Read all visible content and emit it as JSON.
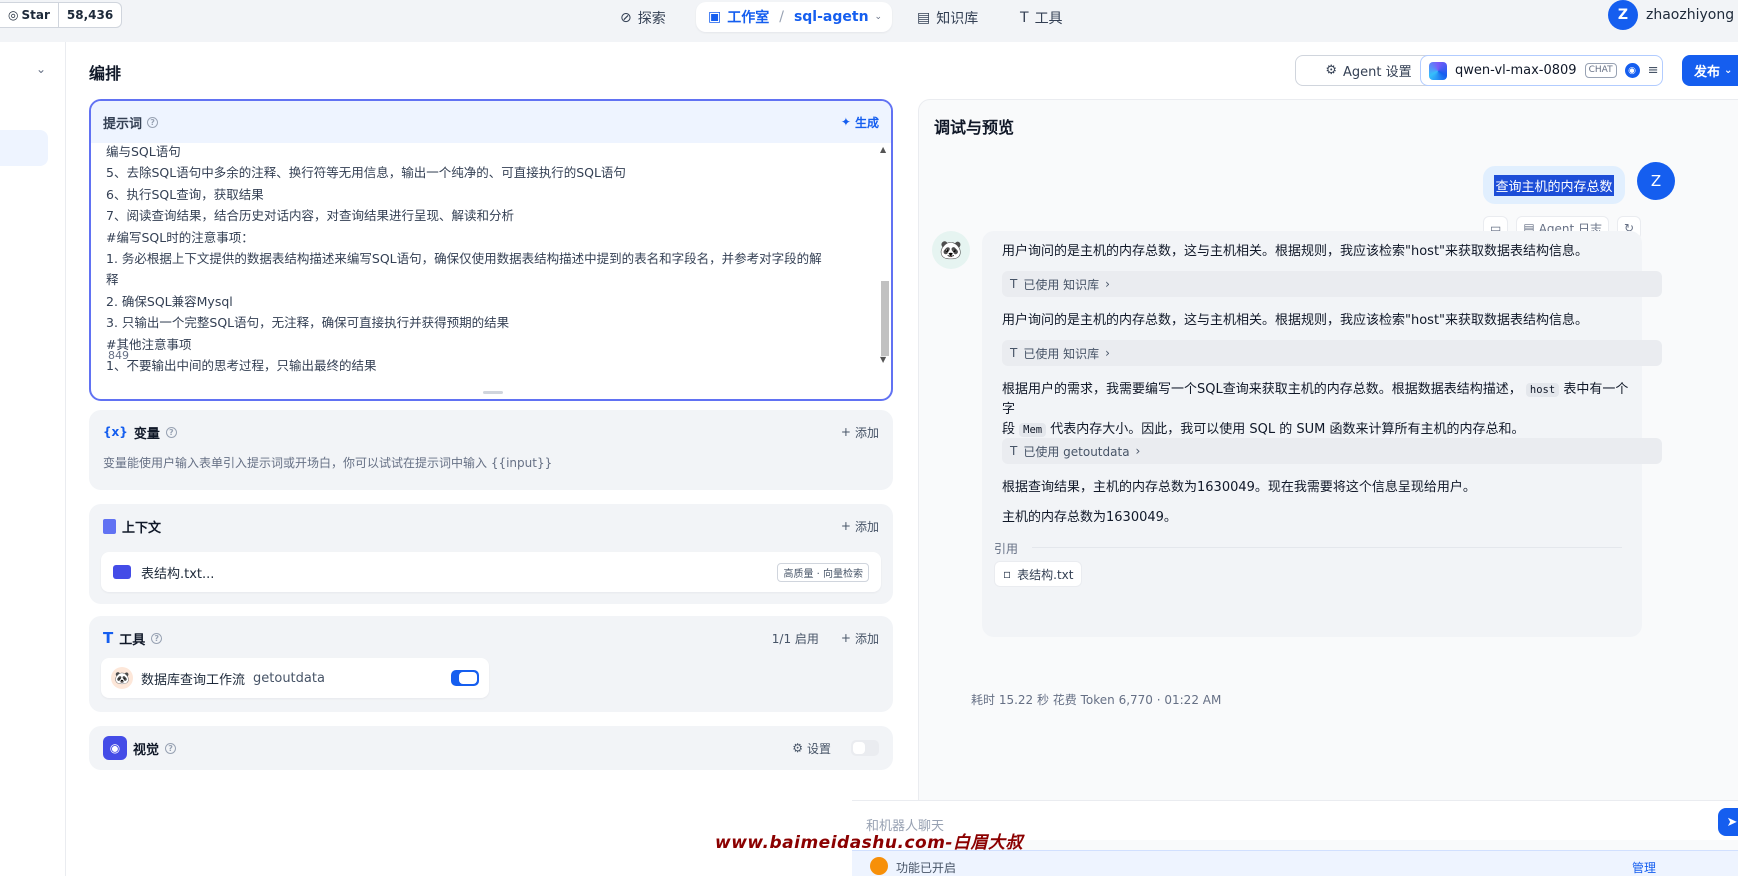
{
  "github": {
    "label": "Star",
    "count": "58,436"
  },
  "nav": {
    "explore": "探索",
    "studio": "工作室",
    "app_name": "sql-agetn",
    "knowledge": "知识库",
    "tools": "工具"
  },
  "user": {
    "initial": "Z",
    "name": "zhaozhiyong"
  },
  "header": {
    "title": "编排",
    "agent_settings": "Agent 设置",
    "model": "qwen-vl-max-0809",
    "model_tag": "CHAT",
    "publish": "发布"
  },
  "prompt": {
    "title": "提示词",
    "generate": "生成",
    "lines": [
      "编与SQL语句",
      "5、去除SQL语句中多余的注释、换行符等无用信息，输出一个纯净的、可直接执行的SQL语句",
      "6、执行SQL查询，获取结果",
      "7、阅读查询结果，结合历史对话内容，对查询结果进行呈现、解读和分析",
      "#编写SQL时的注意事项：",
      "1. 务必根据上下文提供的数据表结构描述来编写SQL语句，确保仅使用数据表结构描述中提到的表名和字段名，并参考对字段的解",
      "释",
      "2. 确保SQL兼容Mysql",
      "3. 只输出一个完整SQL语句，无注释，确保可直接执行并获得预期的结果",
      "#其他注意事项",
      "1、不要输出中间的思考过程，只输出最终的结果"
    ],
    "char_count": "849"
  },
  "variables": {
    "title": "变量",
    "add": "添加",
    "desc": "变量能使用户输入表单引入提示词或开场白，你可以试试在提示词中输入 {{input}}"
  },
  "context": {
    "title": "上下文",
    "add": "添加",
    "file": "表结构.txt...",
    "tag": "高质量 · 向量检索"
  },
  "tools": {
    "title": "工具",
    "enabled": "1/1 启用",
    "add": "添加",
    "item_name": "数据库查询工作流",
    "item_sub": "getoutdata",
    "item_enabled": true
  },
  "vision": {
    "title": "视觉",
    "settings": "设置",
    "enabled": false
  },
  "debug": {
    "title": "调试与预览",
    "user_message": "查询主机的内存总数",
    "agent_log": "Agent 日志",
    "answer": {
      "p1": "用户询问的是主机的内存总数，这与主机相关。根据规则，我应该检索\"host\"来获取数据表结构信息。",
      "used1": "已使用 知识库",
      "p2": "用户询问的是主机的内存总数，这与主机相关。根据规则，我应该检索\"host\"来获取数据表结构信息。",
      "used2": "已使用 知识库",
      "p3a": "根据用户的需求，我需要编写一个SQL查询来获取主机的内存总数。根据数据表结构描述，",
      "p3_code1": "host",
      "p3b": "表中有一个字",
      "p3c": "段",
      "p3_code2": "Mem",
      "p3d": "代表内存大小。因此，我可以使用 SQL 的 SUM 函数来计算所有主机的内存总和。",
      "used3": "已使用 getoutdata",
      "p4": "根据查询结果，主机的内存总数为1630049。现在我需要将这个信息呈现给用户。",
      "p5": "主机的内存总数为1630049。",
      "cite_label": "引用",
      "cite_file": "表结构.txt"
    },
    "meta": "耗时 15.22 秒  花费 Token 6,770  ·  01:22 AM",
    "input_placeholder": "和机器人聊天",
    "feature": "功能已开启",
    "manage": "管理"
  },
  "watermark": "www.baimeidashu.com-白眉大叔"
}
